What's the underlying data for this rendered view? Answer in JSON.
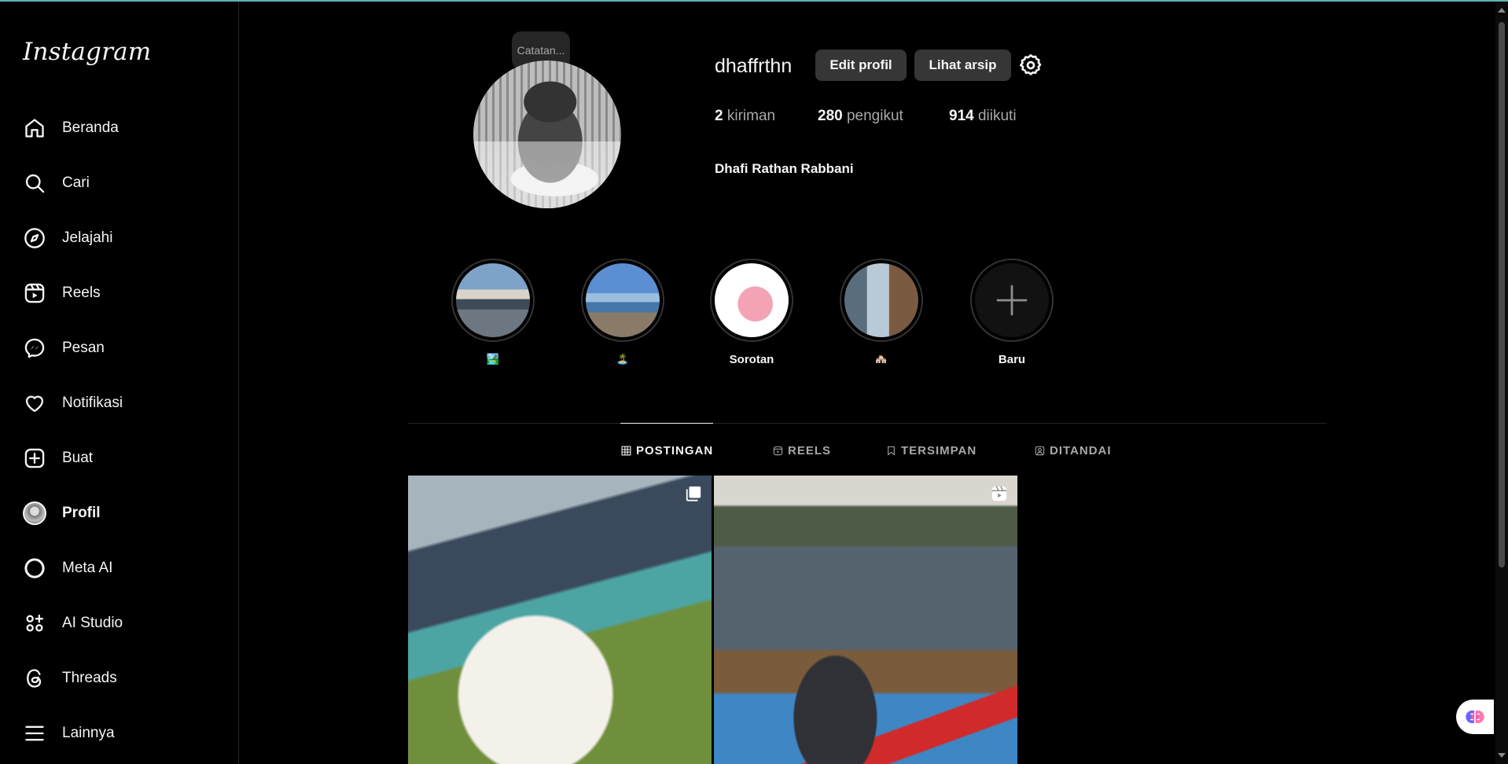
{
  "app": {
    "logo": "Instagram"
  },
  "sidebar": {
    "items": [
      {
        "label": "Beranda",
        "icon": "home-icon"
      },
      {
        "label": "Cari",
        "icon": "search-icon"
      },
      {
        "label": "Jelajahi",
        "icon": "compass-icon"
      },
      {
        "label": "Reels",
        "icon": "reels-icon"
      },
      {
        "label": "Pesan",
        "icon": "messenger-icon"
      },
      {
        "label": "Notifikasi",
        "icon": "heart-icon"
      },
      {
        "label": "Buat",
        "icon": "plus-square-icon"
      },
      {
        "label": "Profil",
        "icon": "avatar"
      },
      {
        "label": "Meta AI",
        "icon": "meta-ai-icon"
      },
      {
        "label": "AI Studio",
        "icon": "ai-studio-icon"
      },
      {
        "label": "Threads",
        "icon": "threads-icon"
      },
      {
        "label": "Lainnya",
        "icon": "menu-icon"
      }
    ],
    "active": "Profil"
  },
  "profile": {
    "note_placeholder": "Catatan...",
    "username": "dhaffrthn",
    "edit_label": "Edit profil",
    "archive_label": "Lihat arsip",
    "stats": {
      "posts_count": "2",
      "posts_label": "kiriman",
      "followers_count": "280",
      "followers_label": "pengikut",
      "following_count": "914",
      "following_label": "diikuti"
    },
    "full_name": "Dhafi Rathan Rabbani"
  },
  "highlights": [
    {
      "caption": "🏞️"
    },
    {
      "caption": "🏝️"
    },
    {
      "caption": "Sorotan"
    },
    {
      "caption": "🏘️"
    },
    {
      "caption": "Baru"
    }
  ],
  "tabs": [
    {
      "label": "POSTINGAN",
      "icon": "grid-icon"
    },
    {
      "label": "REELS",
      "icon": "reels-icon"
    },
    {
      "label": "TERSIMPAN",
      "icon": "bookmark-icon"
    },
    {
      "label": "DITANDAI",
      "icon": "tagged-icon"
    }
  ],
  "active_tab": "POSTINGAN",
  "posts": [
    {
      "type": "carousel",
      "badge_icon": "carousel-icon"
    },
    {
      "type": "reel",
      "badge_icon": "reels-icon"
    }
  ],
  "colors": {
    "background": "#000000",
    "text": "#f5f5f5",
    "secondary": "#a8a8a8",
    "button": "#363636"
  }
}
